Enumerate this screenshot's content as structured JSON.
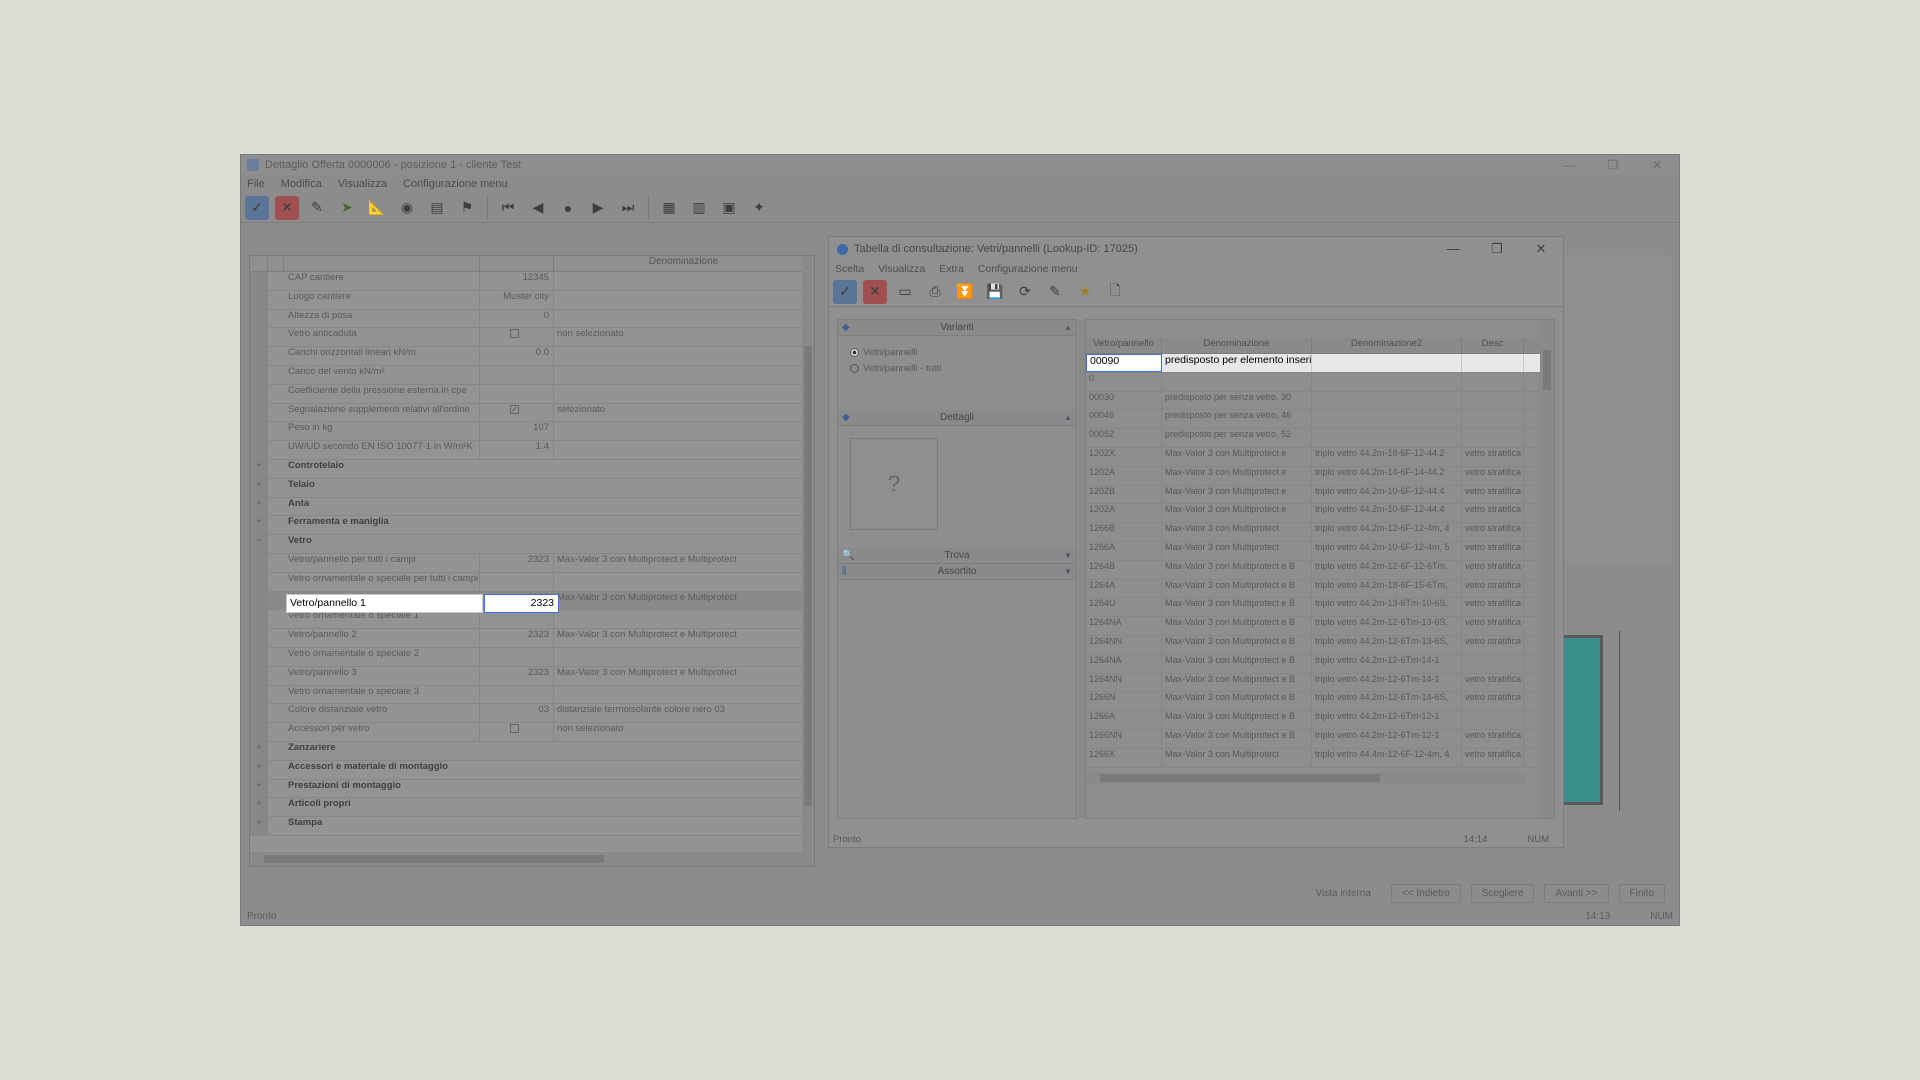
{
  "main": {
    "title": "Dettaglio Offerta 0000006 - posizione 1 - cliente Test",
    "window_controls": [
      "—",
      "❐",
      "✕"
    ],
    "menu": [
      "File",
      "Modifica",
      "Visualizza",
      "Configurazione menu"
    ],
    "grid_header": {
      "col_description": "Denominazione"
    },
    "rows": [
      {
        "label": "CAP cantiere",
        "value": "12345",
        "desc": "",
        "type": "prop"
      },
      {
        "label": "Luogo cantiere",
        "value": "Muster city",
        "desc": "",
        "type": "prop"
      },
      {
        "label": "Altezza di posa",
        "value": "0",
        "desc": "",
        "type": "prop"
      },
      {
        "label": "Vetro anticaduta",
        "value": "",
        "desc": "non selezionato",
        "type": "check",
        "checked": false
      },
      {
        "label": "Carichi orizzontali lineari kN/m",
        "value": "0.0",
        "desc": "",
        "type": "prop"
      },
      {
        "label": "Carico del vento kN/m²",
        "value": "",
        "desc": "",
        "type": "prop"
      },
      {
        "label": "Coefficiente della pressione esterna in cpe",
        "value": "",
        "desc": "",
        "type": "prop"
      },
      {
        "label": "Segnalazione supplementi relativi all'ordine",
        "value": "",
        "desc": "selezionato",
        "type": "check",
        "checked": true
      },
      {
        "label": "Peso in kg",
        "value": "107",
        "desc": "",
        "type": "prop"
      },
      {
        "label": "UW/UD secondo EN ISO 10077-1 in W/m²K",
        "value": "1.4",
        "desc": "",
        "type": "prop"
      },
      {
        "label": "Controtelaio",
        "type": "group"
      },
      {
        "label": "Telaio",
        "type": "group"
      },
      {
        "label": "Anta",
        "type": "group"
      },
      {
        "label": "Ferramenta e maniglia",
        "type": "group"
      },
      {
        "label": "Vetro",
        "type": "group-open"
      },
      {
        "label": "Vetro/pannello per tutti i campi",
        "value": "2323",
        "desc": "Max-Valor 3 con Multiprotect e Multiprotect",
        "type": "prop"
      },
      {
        "label": "Vetro ornamentale o speciale per tutti i campi",
        "value": "",
        "desc": "",
        "type": "prop"
      },
      {
        "label": "Vetro/pannello 1",
        "value": "2323",
        "desc": "Max-Valor 3 con Multiprotect e Multiprotect",
        "type": "active"
      },
      {
        "label": "Vetro ornamentale o speciale 1",
        "value": "",
        "desc": "",
        "type": "prop"
      },
      {
        "label": "Vetro/pannello 2",
        "value": "2323",
        "desc": "Max-Valor 3 con Multiprotect e Multiprotect",
        "type": "prop"
      },
      {
        "label": "Vetro ornamentale o speciale 2",
        "value": "",
        "desc": "",
        "type": "prop"
      },
      {
        "label": "Vetro/pannello 3",
        "value": "2323",
        "desc": "Max-Valor 3 con Multiprotect e Multiprotect",
        "type": "prop"
      },
      {
        "label": "Vetro ornamentale o speciale 3",
        "value": "",
        "desc": "",
        "type": "prop"
      },
      {
        "label": "Colore distanziale vetro",
        "value": "03",
        "desc": "distanziale termoisolante colore nero 03",
        "type": "prop"
      },
      {
        "label": "Accessori per vetro",
        "value": "",
        "desc": "non selezionato",
        "type": "check",
        "checked": false
      },
      {
        "label": "Zanzariere",
        "type": "group"
      },
      {
        "label": "Accessori e materiale di montaggio",
        "type": "group"
      },
      {
        "label": "Prestazioni di montaggio",
        "type": "group"
      },
      {
        "label": "Articoli propri",
        "type": "group"
      },
      {
        "label": "Stampa",
        "type": "group"
      }
    ],
    "edit": {
      "label": "Vetro/pannello 1",
      "value": "2323"
    },
    "footer": {
      "view_label": "Vista interna",
      "back": "<< Indietro",
      "choose": "Scegliere",
      "next": "Avanti >>",
      "finish": "Finito"
    },
    "status": {
      "left": "Pronto",
      "time": "14:13",
      "num": "NUM"
    }
  },
  "dialog": {
    "title": "Tabella di consultazione: Vetri/pannelli (Lookup-ID: 17025)",
    "window_controls": [
      "—",
      "❐",
      "✕"
    ],
    "menu": [
      "Scelta",
      "Visualizza",
      "Extra",
      "Configurazione menu"
    ],
    "variants_head": "Varianti",
    "radio": [
      {
        "label": "Vetri/pannelli",
        "on": true
      },
      {
        "label": "Vetri/pannelli - tutti",
        "on": false
      }
    ],
    "details_head": "Dettagli",
    "image_placeholder": "?",
    "search_head": "Trova",
    "assort_head": "Assortito",
    "columns": [
      "Vetro/pannello",
      "Denominazione",
      "Denominazione2",
      "Desc"
    ],
    "rows": [
      [
        "00090",
        "predisposto per elemento inserit",
        "",
        ""
      ],
      [
        "0",
        "",
        "",
        ""
      ],
      [
        "00030",
        "predisposto per senza vetro, 30",
        "",
        ""
      ],
      [
        "00046",
        "predisposto per senza vetro, 46",
        "",
        ""
      ],
      [
        "00052",
        "predisposto per senza vetro, 52",
        "",
        ""
      ],
      [
        "1202X",
        "Max-Valor 3 con Multiprotect e",
        "triplo vetro 44.2m-18-6F-12-44.2",
        "vetro stratifica"
      ],
      [
        "1202A",
        "Max-Valor 3 con Multiprotect e",
        "triplo vetro 44.2m-14-6F-14-44.2",
        "vetro stratifica"
      ],
      [
        "1202B",
        "Max-Valor 3 con Multiprotect e",
        "triplo vetro 44.2m-10-6F-12-44.4",
        "vetro stratifica"
      ],
      [
        "1202A",
        "Max-Valor 3 con Multiprotect e",
        "triplo vetro 44.2m-10-6F-12-44.4",
        "vetro stratifica"
      ],
      [
        "1266B",
        "Max-Valor 3 con Multiprotect",
        "triplo vetro 44.2m-12-6F-12-4m, 4",
        "vetro stratifica"
      ],
      [
        "1266A",
        "Max-Valor 3 con Multiprotect",
        "triplo vetro 44.2m-10-6F-12-4m, 5",
        "vetro stratifica"
      ],
      [
        "1264B",
        "Max-Valor 3 con Multiprotect e B",
        "triplo vetro 44.2m-12-6F-12-6Tm,",
        "vetro stratifica"
      ],
      [
        "1264A",
        "Max-Valor 3 con Multiprotect e B",
        "triplo vetro 44.2m-18-6F-15-6Tm,",
        "vetro stratifica"
      ],
      [
        "1264U",
        "Max-Valor 3 con Multiprotect e B",
        "triplo vetro 44.2m-13-6Tm-10-6S,",
        "vetro stratifica"
      ],
      [
        "1264NA",
        "Max-Valor 3 con Multiprotect e B",
        "triplo vetro 44.2m-12-6Tm-13-6S,",
        "vetro stratifica"
      ],
      [
        "1264NN",
        "Max-Valor 3 con Multiprotect e B",
        "triplo vetro 44.2m-12-6Tm-13-6S,",
        "vetro stratifica"
      ],
      [
        "1264NA",
        "Max-Valor 3 con Multiprotect e B",
        "triplo vetro 44.2m-12-6Tm-14-1",
        ""
      ],
      [
        "1264NN",
        "Max-Valor 3 con Multiprotect e B",
        "triplo vetro 44.2m-12-6Tm-14-1",
        "vetro stratifica"
      ],
      [
        "1266N",
        "Max-Valor 3 con Multiprotect e B",
        "triplo vetro 44.2m-12-6Tm-14-6S,",
        "vetro stratifica"
      ],
      [
        "1266A",
        "Max-Valor 3 con Multiprotect e B",
        "triplo vetro 44.2m-12-6Tm-12-1",
        ""
      ],
      [
        "1266NN",
        "Max-Valor 3 con Multiprotect e B",
        "triplo vetro 44.2m-12-6Tm-12-1",
        "vetro stratifica"
      ],
      [
        "1266X",
        "Max-Valor 3 con Multiprotect",
        "triplo vetro 44.4m-12-6F-12-4m, 4",
        "vetro stratifica"
      ]
    ],
    "status": {
      "left": "Pronto",
      "time": "14:14",
      "num": "NUM"
    }
  }
}
